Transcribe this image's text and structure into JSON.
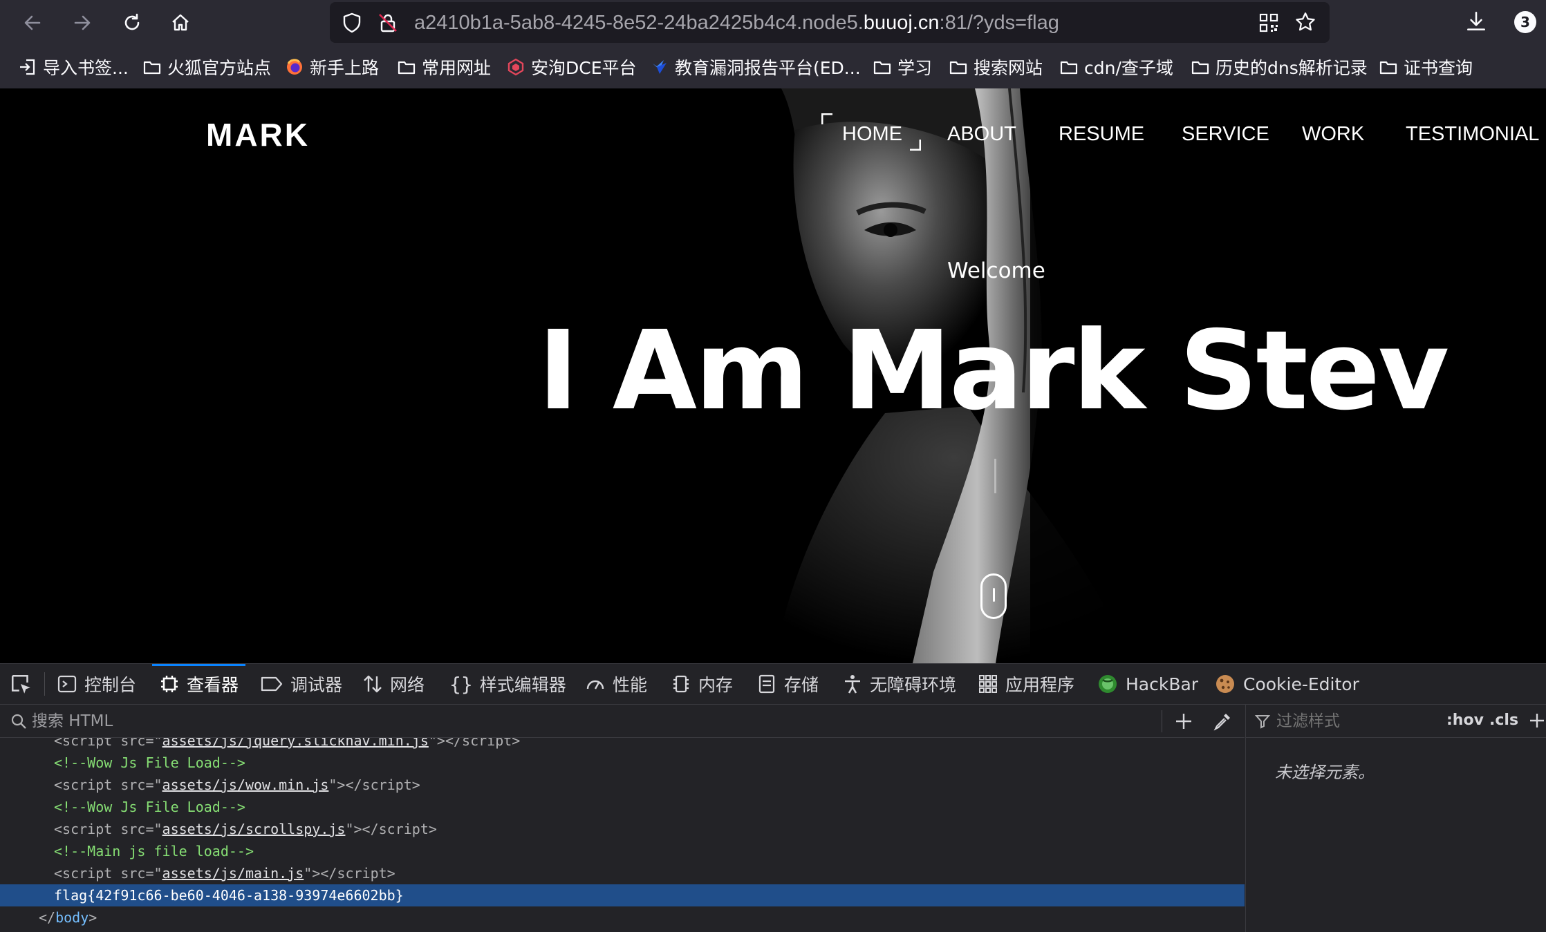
{
  "browser": {
    "url_prefix": "a2410b1a-5ab8-4245-8e52-24ba2425b4c4.node5.",
    "url_domain": "buuoj.cn",
    "url_suffix": ":81/?yds=flag",
    "downloads_badge": "3"
  },
  "bookmarks": [
    {
      "label": "导入书签...",
      "icon": "import-icon"
    },
    {
      "label": "火狐官方站点",
      "icon": "folder-icon"
    },
    {
      "label": "新手上路",
      "icon": "firefox-icon"
    },
    {
      "label": "常用网址",
      "icon": "folder-icon"
    },
    {
      "label": "安洵DCE平台",
      "icon": "dce-icon"
    },
    {
      "label": "教育漏洞报告平台(ED...",
      "icon": "edu-icon"
    },
    {
      "label": "学习",
      "icon": "folder-icon"
    },
    {
      "label": "搜索网站",
      "icon": "folder-icon"
    },
    {
      "label": "cdn/查子域",
      "icon": "folder-icon"
    },
    {
      "label": "历史的dns解析记录",
      "icon": "folder-icon"
    },
    {
      "label": "证书查询",
      "icon": "folder-icon"
    }
  ],
  "site": {
    "logo": "MARK",
    "nav": [
      "HOME",
      "ABOUT",
      "RESUME",
      "SERVICE",
      "WORK",
      "TESTIMONIAL"
    ],
    "welcome": "Welcome",
    "headline": "I Am Mark Stev"
  },
  "devtools": {
    "tabs": [
      {
        "label": "控制台",
        "icon": "console-icon"
      },
      {
        "label": "查看器",
        "icon": "inspector-icon"
      },
      {
        "label": "调试器",
        "icon": "debugger-icon"
      },
      {
        "label": "网络",
        "icon": "network-icon"
      },
      {
        "label": "样式编辑器",
        "icon": "style-editor-icon"
      },
      {
        "label": "性能",
        "icon": "performance-icon"
      },
      {
        "label": "内存",
        "icon": "memory-icon"
      },
      {
        "label": "存储",
        "icon": "storage-icon"
      },
      {
        "label": "无障碍环境",
        "icon": "accessibility-icon"
      },
      {
        "label": "应用程序",
        "icon": "application-icon"
      },
      {
        "label": "HackBar",
        "icon": "hackbar-icon"
      },
      {
        "label": "Cookie-Editor",
        "icon": "cookie-icon"
      }
    ],
    "search_placeholder": "搜索 HTML",
    "filter_placeholder": "过滤样式",
    "hov": ":hov",
    "cls": ".cls",
    "no_element": "未选择元素。",
    "code_lines": [
      {
        "type": "script",
        "src": "assets/js/jquery.slicknav.min.js"
      },
      {
        "type": "comment",
        "text": "<!--Wow Js File Load-->"
      },
      {
        "type": "script",
        "src": "assets/js/wow.min.js"
      },
      {
        "type": "comment",
        "text": "<!--Wow Js File Load-->"
      },
      {
        "type": "script",
        "src": "assets/js/scrollspy.js"
      },
      {
        "type": "comment",
        "text": "<!--Main js file load-->"
      },
      {
        "type": "script",
        "src": "assets/js/main.js"
      },
      {
        "type": "text",
        "text": "flag{42f91c66-be60-4046-a138-93974e6602bb}",
        "selected": true
      },
      {
        "type": "close",
        "text": "</body>"
      }
    ]
  }
}
